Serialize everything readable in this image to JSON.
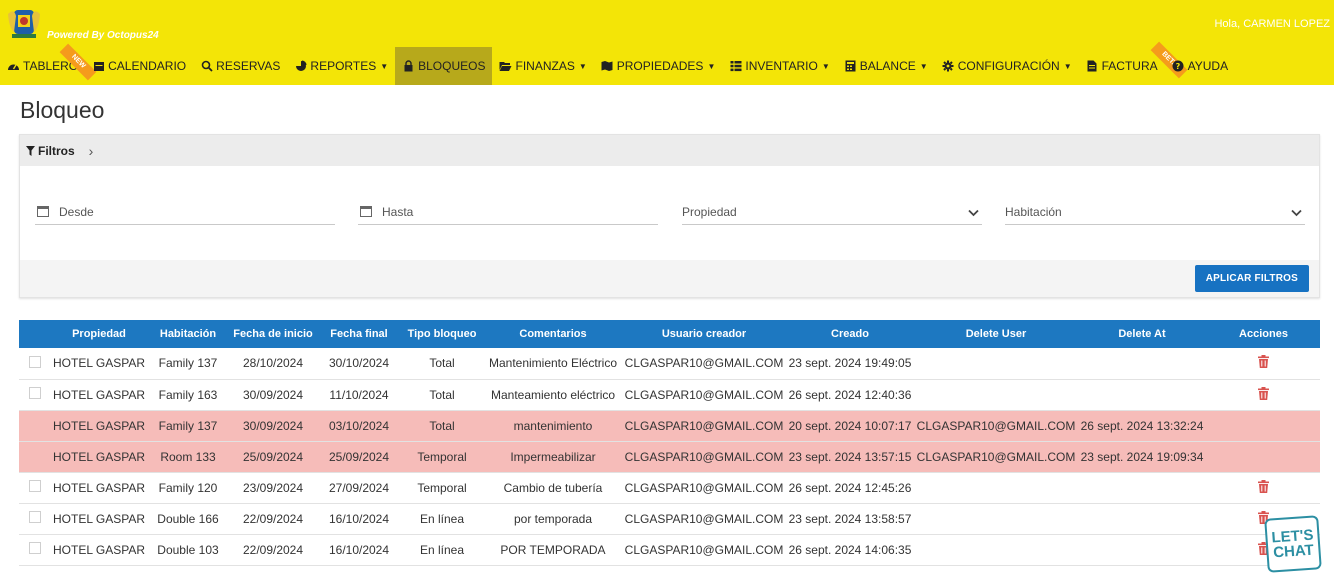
{
  "header": {
    "powered": "Powered By Octopus24",
    "greeting": "Hola, CARMEN LOPEZ"
  },
  "nav": {
    "tablero": "TABLERO",
    "calendario": "CALENDARIO",
    "reservas": "RESERVAS",
    "reportes": "REPORTES",
    "bloqueos": "BLOQUEOS",
    "finanzas": "FINANZAS",
    "propiedades": "PROPIEDADES",
    "inventario": "INVENTARIO",
    "balance": "BALANCE",
    "configuracion": "CONFIGURACIÓN",
    "factura": "FACTURA",
    "ayuda": "AYUDA",
    "badge_new": "NEW",
    "badge_beta": "BETA"
  },
  "page": {
    "title": "Bloqueo"
  },
  "filters": {
    "heading": "Filtros",
    "desde": "Desde",
    "hasta": "Hasta",
    "propiedad": "Propiedad",
    "habitacion": "Habitación",
    "apply": "APLICAR FILTROS"
  },
  "table": {
    "headers": {
      "propiedad": "Propiedad",
      "habitacion": "Habitación",
      "inicio": "Fecha de inicio",
      "final": "Fecha final",
      "tipo": "Tipo bloqueo",
      "comentarios": "Comentarios",
      "usuario": "Usuario creador",
      "creado": "Creado",
      "delete_user": "Delete User",
      "delete_at": "Delete At",
      "acciones": "Acciones"
    },
    "rows": [
      {
        "propiedad": "HOTEL GASPAR",
        "habitacion": "Family 137",
        "inicio": "28/10/2024",
        "final": "30/10/2024",
        "tipo": "Total",
        "comentarios": "Mantenimiento Eléctrico",
        "usuario": "CLGASPAR10@GMAIL.COM",
        "creado": "23 sept. 2024 19:49:05",
        "delete_user": "",
        "delete_at": "",
        "deleted": false
      },
      {
        "propiedad": "HOTEL GASPAR",
        "habitacion": "Family 163",
        "inicio": "30/09/2024",
        "final": "11/10/2024",
        "tipo": "Total",
        "comentarios": "Manteamiento eléctrico",
        "usuario": "CLGASPAR10@GMAIL.COM",
        "creado": "26 sept. 2024 12:40:36",
        "delete_user": "",
        "delete_at": "",
        "deleted": false
      },
      {
        "propiedad": "HOTEL GASPAR",
        "habitacion": "Family 137",
        "inicio": "30/09/2024",
        "final": "03/10/2024",
        "tipo": "Total",
        "comentarios": "mantenimiento",
        "usuario": "CLGASPAR10@GMAIL.COM",
        "creado": "20 sept. 2024 10:07:17",
        "delete_user": "CLGASPAR10@GMAIL.COM",
        "delete_at": "26 sept. 2024 13:32:24",
        "deleted": true
      },
      {
        "propiedad": "HOTEL GASPAR",
        "habitacion": "Room 133",
        "inicio": "25/09/2024",
        "final": "25/09/2024",
        "tipo": "Temporal",
        "comentarios": "Impermeabilizar",
        "usuario": "CLGASPAR10@GMAIL.COM",
        "creado": "23 sept. 2024 13:57:15",
        "delete_user": "CLGASPAR10@GMAIL.COM",
        "delete_at": "23 sept. 2024 19:09:34",
        "deleted": true
      },
      {
        "propiedad": "HOTEL GASPAR",
        "habitacion": "Family 120",
        "inicio": "23/09/2024",
        "final": "27/09/2024",
        "tipo": "Temporal",
        "comentarios": "Cambio de tubería",
        "usuario": "CLGASPAR10@GMAIL.COM",
        "creado": "26 sept. 2024 12:45:26",
        "delete_user": "",
        "delete_at": "",
        "deleted": false
      },
      {
        "propiedad": "HOTEL GASPAR",
        "habitacion": "Double 166",
        "inicio": "22/09/2024",
        "final": "16/10/2024",
        "tipo": "En línea",
        "comentarios": "por temporada",
        "usuario": "CLGASPAR10@GMAIL.COM",
        "creado": "23 sept. 2024 13:58:57",
        "delete_user": "",
        "delete_at": "",
        "deleted": false
      },
      {
        "propiedad": "HOTEL GASPAR",
        "habitacion": "Double 103",
        "inicio": "22/09/2024",
        "final": "16/10/2024",
        "tipo": "En línea",
        "comentarios": "POR TEMPORADA",
        "usuario": "CLGASPAR10@GMAIL.COM",
        "creado": "26 sept. 2024 14:06:35",
        "delete_user": "",
        "delete_at": "",
        "deleted": false
      }
    ]
  },
  "chat": {
    "line1": "LET'S",
    "line2": "CHAT"
  },
  "colors": {
    "header_bg": "#f3e507",
    "active_nav": "#b7a91b",
    "table_head": "#1d78c1",
    "deleted_row": "#f6bcb9",
    "apply_button": "#1772c2",
    "trash": "#d9534f"
  }
}
